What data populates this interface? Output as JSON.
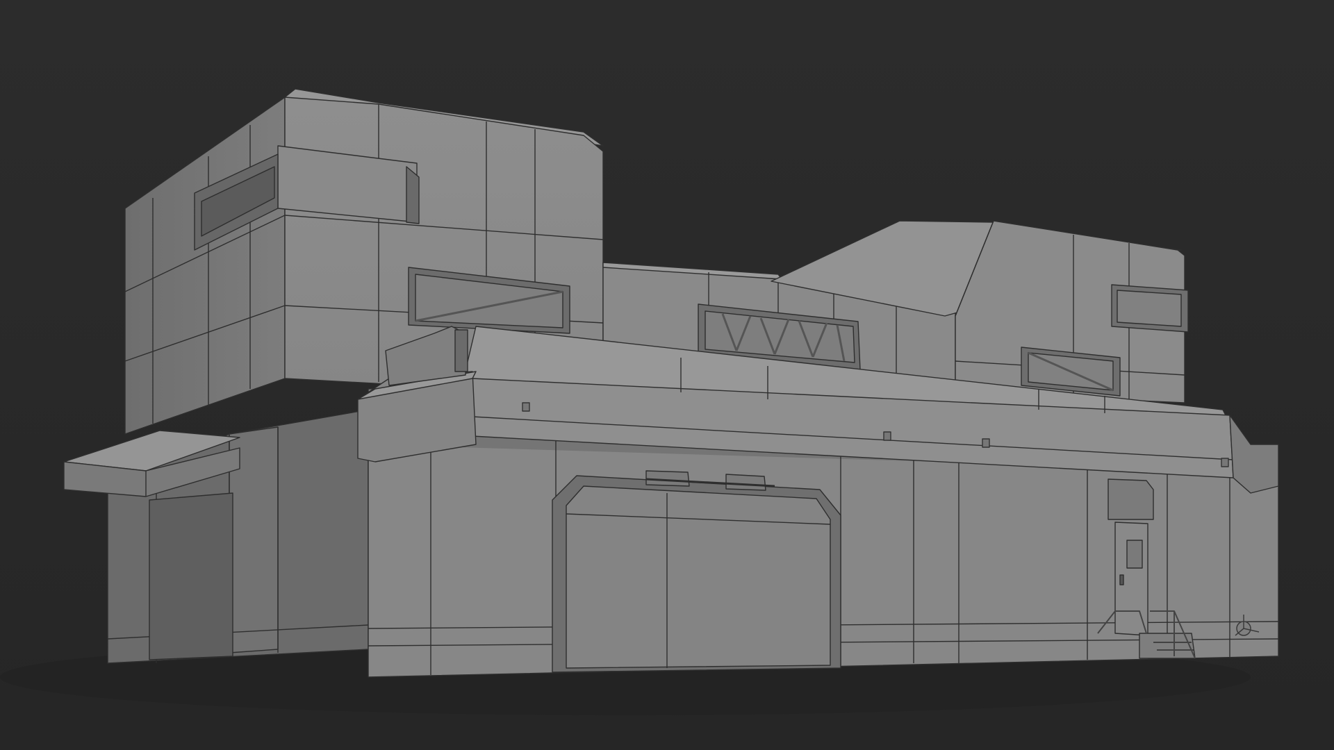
{
  "scene": {
    "background_color": "#2b2b2b",
    "floor_shadow_color": "#242424",
    "model_color_light": "#8c8c8c",
    "model_color_mid": "#7a7a7a",
    "model_color_dark": "#5e5e5e",
    "wire_color": "#2e2e2e"
  },
  "icons": {
    "gizmo": "view-axis-gizmo-icon"
  }
}
